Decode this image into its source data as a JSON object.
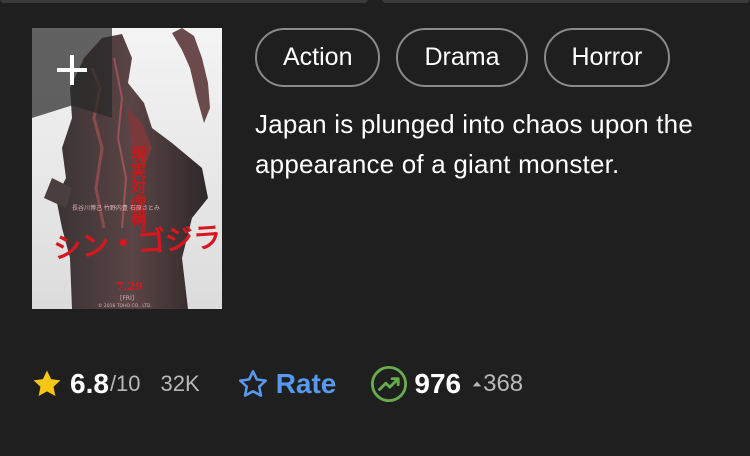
{
  "poster": {
    "alt": "Shin Godzilla poster",
    "title_jp": "シン・ゴジラ",
    "tagline_jp": "現実対虚構。",
    "date": "7.29",
    "day": "[FRI]",
    "credit_line_1": "長谷川博己 竹野内豊 石原さとみ",
    "copyright": "© 2016 TOHO CO., LTD."
  },
  "genres": [
    "Action",
    "Drama",
    "Horror"
  ],
  "plot": "Japan is plunged into chaos upon the appearance of a giant monster.",
  "rating": {
    "score": "6.8",
    "out_of": "/10",
    "votes": "32K"
  },
  "rate_label": "Rate",
  "popularity": {
    "rank": "976",
    "change": "368"
  },
  "colors": {
    "background": "#1f1f1f",
    "star": "#f5c518",
    "rate_blue": "#5799ef",
    "popularity_green": "#67ad4b",
    "muted": "#b8b8b8",
    "chip_border": "#8a8a8a"
  },
  "icons": {
    "watchlist": "plus-icon",
    "star": "star-filled-icon",
    "rate": "star-outline-icon",
    "popularity": "trending-up-icon",
    "delta": "caret-up-icon"
  }
}
